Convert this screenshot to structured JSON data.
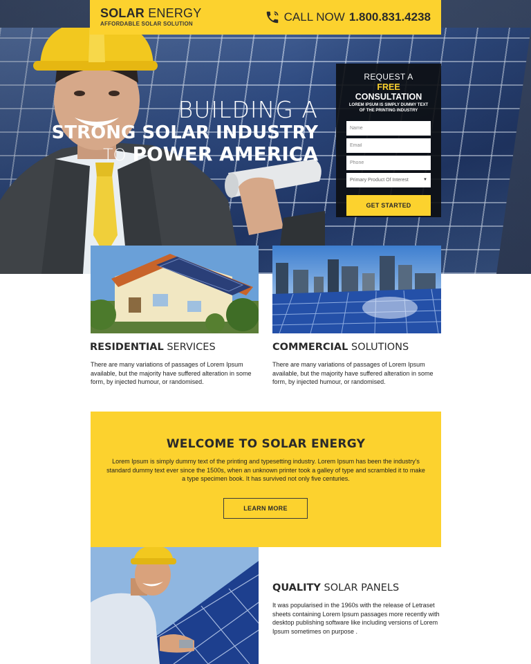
{
  "header": {
    "logo_strong": "SOLAR",
    "logo_light": "ENERGY",
    "tagline": "AFFORDABLE SOLAR SOLUTION",
    "call_label": "CALL NOW",
    "phone": "1.800.831.4238",
    "phone_icon": "phone-icon",
    "accent": "#fcd22e"
  },
  "hero": {
    "line1": "BUILDING A",
    "line2": "STRONG SOLAR INDUSTRY",
    "line3_prefix": "TO",
    "line3_strong": "POWER AMERICA"
  },
  "form": {
    "title_line1": "REQUEST A",
    "title_free": "FREE",
    "title_rest": "CONSULTATION",
    "subtitle": "LOREM IPSUM IS SIMPLY DUMMY TEXT OF THE PRINTING INDUSTRY",
    "name_placeholder": "Name",
    "email_placeholder": "Email",
    "phone_placeholder": "Phone",
    "select_value": "Primary Product Of Interest",
    "submit_label": "GET STARTED"
  },
  "services": [
    {
      "title_strong": "RESIDENTIAL",
      "title_light": "SERVICES",
      "text": "There are many variations of passages of Lorem Ipsum available, but the majority have suffered alteration in some form, by injected humour, or randomised."
    },
    {
      "title_strong": "COMMERCIAL",
      "title_light": "SOLUTIONS",
      "text": "There are many variations of passages of Lorem Ipsum available, but the majority have suffered alteration in some form, by injected humour, or randomised."
    }
  ],
  "welcome": {
    "title": "WELCOME TO SOLAR ENERGY",
    "text": "Lorem Ipsum is simply dummy text of the printing and typesetting industry. Lorem Ipsum has been the industry's standard dummy text ever since the 1500s, when an unknown printer took a galley of type and scrambled it to make a type specimen book. It has survived not only five centuries.",
    "button_label": "LEARN MORE"
  },
  "quality": {
    "title_strong": "QUALITY",
    "title_light": "SOLAR PANELS",
    "text": "It was popularised in the 1960s with the release of Letraset sheets containing Lorem Ipsum passages more recently with desktop publishing software like including versions of Lorem Ipsum sometimes on purpose ."
  }
}
